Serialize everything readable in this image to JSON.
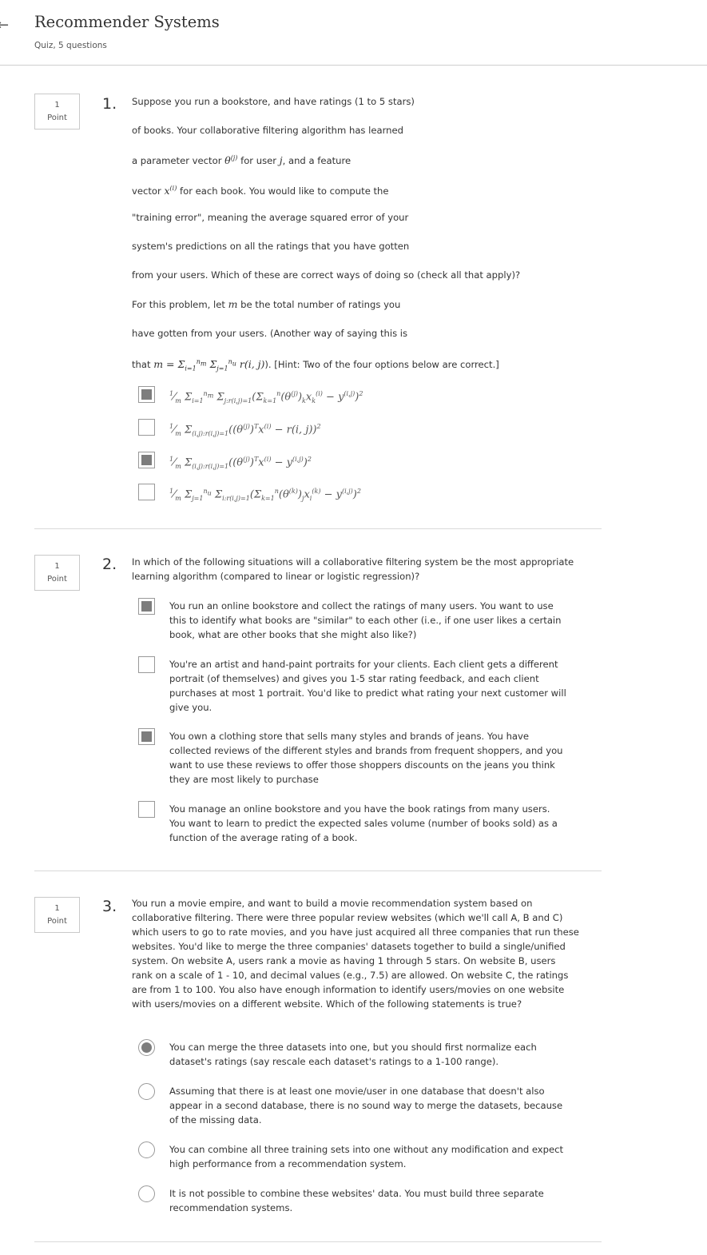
{
  "header": {
    "back_icon": "arrow-left-icon",
    "title": "Recommender Systems",
    "subtitle": "Quiz, 5 questions"
  },
  "questions": [
    {
      "number": "1.",
      "points": "1",
      "points_label": "Point",
      "lines": [
        "Suppose you run a bookstore, and have ratings (1 to 5 stars)",
        "of books. Your collaborative filtering algorithm has learned",
        "a parameter vector θ(j) for user j, and a feature",
        "vector x(i) for each book. You would like to compute the",
        "\"training error\", meaning the average squared error of your",
        "system's predictions on all the ratings that you have gotten",
        "from your users. Which of these are correct ways of doing so (check all that apply)?",
        "For this problem, let m be the total number of ratings you",
        "have gotten from your users. (Another way of saying this is",
        "that m = Σi=1nm Σj=1nu r(i,j)). [Hint: Two of the four options below are correct.]"
      ],
      "options": [
        {
          "text": "1/m Σi=1nm Σj:r(i,j)=1 (Σk=1n (θ(j))k xk(i) − y(i,j))2",
          "checked": true
        },
        {
          "text": "1/m Σ(i,j):r(i,j)=1 ((θ(j))T x(i) − r(i,j))2",
          "checked": false
        },
        {
          "text": "1/m Σ(i,j):r(i,j)=1 ((θ(j))T x(i) − y(i,j))2",
          "checked": true
        },
        {
          "text": "1/m Σj=1nu Σi:r(i,j)=1 (Σk=1n (θ(k))j xi(k) − y(i,j))2",
          "checked": false
        }
      ]
    },
    {
      "number": "2.",
      "points": "1",
      "points_label": "Point",
      "text": "In which of the following situations will a collaborative filtering system be the most appropriate learning algorithm (compared to linear or logistic regression)?",
      "options": [
        {
          "text": "You run an online bookstore and collect the ratings of many users. You want to use this to identify what books are \"similar\" to each other (i.e., if one user likes a certain book, what are other books that she might also like?)",
          "checked": true
        },
        {
          "text": "You're an artist and hand-paint portraits for your clients. Each client gets a different portrait (of themselves) and gives you 1-5 star rating feedback, and each client purchases at most 1 portrait. You'd like to predict what rating your next customer will give you.",
          "checked": false
        },
        {
          "text": "You own a clothing store that sells many styles and brands of jeans. You have collected reviews of the different styles and brands from frequent shoppers, and you want to use these reviews to offer those shoppers discounts on the jeans you think they are most likely to purchase",
          "checked": true
        },
        {
          "text": "You manage an online bookstore and you have the book ratings from many users. You want to learn to predict the expected sales volume (number of books sold) as a function of the average rating of a book.",
          "checked": false
        }
      ]
    },
    {
      "number": "3.",
      "points": "1",
      "points_label": "Point",
      "text": "You run a movie empire, and want to build a movie recommendation system based on collaborative filtering. There were three popular review websites (which we'll call A, B and C) which users to go to rate movies, and you have just acquired all three companies that run these websites. You'd like to merge the three companies' datasets together to build a single/unified system. On website A, users rank a movie as having 1 through 5 stars. On website B, users rank on a scale of 1 - 10, and decimal values (e.g., 7.5) are allowed. On website C, the ratings are from 1 to 100. You also have enough information to identify users/movies on one website with users/movies on a different website. Which of the following statements is true?",
      "options": [
        {
          "text": "You can merge the three datasets into one, but you should first normalize each dataset's ratings (say rescale each dataset's ratings to a 1-100 range).",
          "selected": true
        },
        {
          "text": "Assuming that there is at least one movie/user in one database that doesn't also appear in a second database, there is no sound way to merge the datasets, because of the missing data.",
          "selected": false
        },
        {
          "text": "You can combine all three training sets into one without any modification and expect high performance from a recommendation system.",
          "selected": false
        },
        {
          "text": "It is not possible to combine these websites' data. You must build three separate recommendation systems.",
          "selected": false
        }
      ]
    }
  ]
}
